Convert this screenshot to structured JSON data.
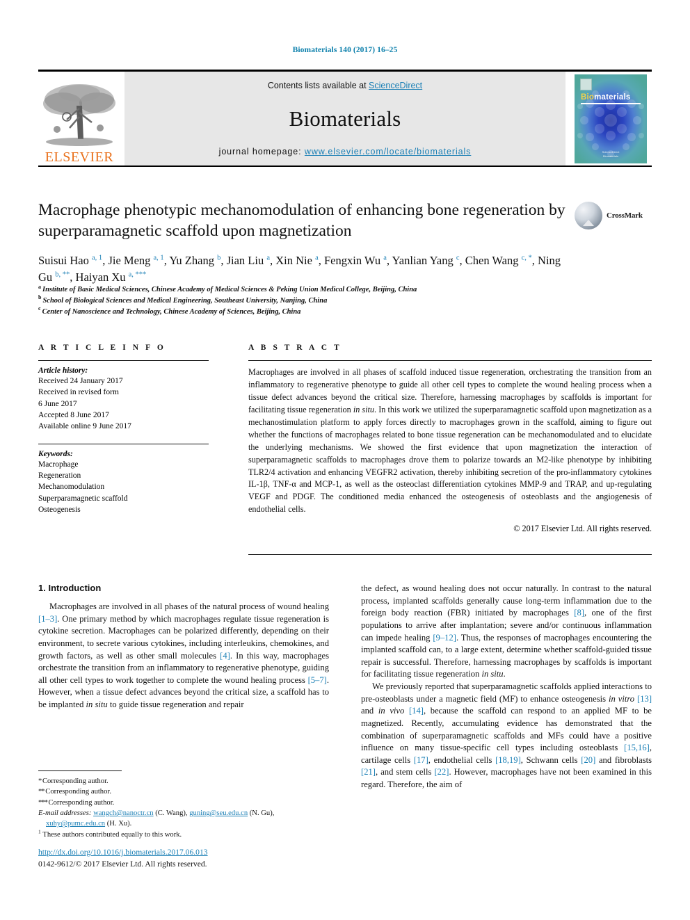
{
  "running_head": "Biomaterials 140 (2017) 16–25",
  "masthead": {
    "publisher_name": "ELSEVIER",
    "contents_line_prefix": "Contents lists available at ",
    "contents_line_link": "ScienceDirect",
    "journal_title": "Biomaterials",
    "homepage_prefix": "journal homepage: ",
    "homepage_url": "www.elsevier.com/locate/biomaterials",
    "cover": {
      "title_first": "Bio",
      "title_rest": "materials",
      "footer_line1": "ScienceDirect",
      "footer_line2": "Biomaterials"
    }
  },
  "article": {
    "title": "Macrophage phenotypic mechanomodulation of enhancing bone regeneration by superparamagnetic scaffold upon magnetization",
    "crossmark_label": "CrossMark",
    "authors": [
      {
        "name": "Suisui Hao",
        "marks": "a, 1",
        "sep": ", "
      },
      {
        "name": "Jie Meng",
        "marks": "a, 1",
        "sep": ", "
      },
      {
        "name": "Yu Zhang",
        "marks": "b",
        "sep": ", "
      },
      {
        "name": "Jian Liu",
        "marks": "a",
        "sep": ", "
      },
      {
        "name": "Xin Nie",
        "marks": "a",
        "sep": ", "
      },
      {
        "name": "Fengxin Wu",
        "marks": "a",
        "sep": ", "
      },
      {
        "name": "Yanlian Yang",
        "marks": "c",
        "sep": ", "
      },
      {
        "name": "Chen Wang",
        "marks": "c, *",
        "sep": ", "
      },
      {
        "name": "Ning Gu",
        "marks": "b, **",
        "sep": ", "
      },
      {
        "name": "Haiyan Xu",
        "marks": "a, ***",
        "sep": ""
      }
    ],
    "affiliations": [
      {
        "mark": "a",
        "text": "Institute of Basic Medical Sciences, Chinese Academy of Medical Sciences & Peking Union Medical College, Beijing, China"
      },
      {
        "mark": "b",
        "text": "School of Biological Sciences and Medical Engineering, Southeast University, Nanjing, China"
      },
      {
        "mark": "c",
        "text": "Center of Nanoscience and Technology, Chinese Academy of Sciences, Beijing, China"
      }
    ]
  },
  "article_info": {
    "heading": "A R T I C L E  I N F O",
    "history_heading": "Article history:",
    "history": [
      "Received 24 January 2017",
      "Received in revised form",
      "6 June 2017",
      "Accepted 8 June 2017",
      "Available online 9 June 2017"
    ],
    "keywords_heading": "Keywords:",
    "keywords": [
      "Macrophage",
      "Regeneration",
      "Mechanomodulation",
      "Superparamagnetic scaffold",
      "Osteogenesis"
    ]
  },
  "abstract": {
    "heading": "A B S T R A C T",
    "paragraph_parts": [
      {
        "t": "Macrophages are involved in all phases of scaffold induced tissue regeneration, orchestrating the transition from an inflammatory to regenerative phenotype to guide all other cell types to complete the wound healing process when a tissue defect advances beyond the critical size. Therefore, harnessing macrophages by scaffolds is important for facilitating tissue regeneration ",
        "i": false
      },
      {
        "t": "in situ",
        "i": true
      },
      {
        "t": ". In this work we utilized the superparamagnetic scaffold upon magnetization as a mechanostimulation platform to apply forces directly to macrophages grown in the scaffold, aiming to figure out whether the functions of macrophages related to bone tissue regeneration can be mechanomodulated and to elucidate the underlying mechanisms. We showed the first evidence that upon magnetization the interaction of superparamagnetic scaffolds to macrophages drove them to polarize towards an M2-like phenotype by inhibiting TLR2/4 activation and enhancing VEGFR2 activation, thereby inhibiting secretion of the pro-inflammatory cytokines IL-1β, TNF-α and MCP-1, as well as the osteoclast differentiation cytokines MMP-9 and TRAP, and up-regulating VEGF and PDGF. The conditioned media enhanced the osteogenesis of osteoblasts and the angiogenesis of endothelial cells.",
        "i": false
      }
    ],
    "copyright": "© 2017 Elsevier Ltd. All rights reserved."
  },
  "body": {
    "section_heading": "1. Introduction",
    "left_paragraph_1": "Macrophages are involved in all phases of the natural process of wound healing [1–3]. One primary method by which macrophages regulate tissue regeneration is cytokine secretion. Macrophages can be polarized differently, depending on their environment, to secrete various cytokines, including interleukins, chemokines, and growth factors, as well as other small molecules [4]. In this way, macrophages orchestrate the transition from an inflammatory to regenerative phenotype, guiding all other cell types to work together to complete the wound healing process [5–7]. However, when a tissue defect advances beyond the critical size, a scaffold has to be implanted in situ to guide tissue regeneration and repair",
    "right_paragraph_1": "the defect, as wound healing does not occur naturally. In contrast to the natural process, implanted scaffolds generally cause long-term inflammation due to the foreign body reaction (FBR) initiated by macrophages [8], one of the first populations to arrive after implantation; severe and/or continuous inflammation can impede healing [9–12]. Thus, the responses of macrophages encountering the implanted scaffold can, to a large extent, determine whether scaffold-guided tissue repair is successful. Therefore, harnessing macrophages by scaffolds is important for facilitating tissue regeneration in situ.",
    "right_paragraph_2": "We previously reported that superparamagnetic scaffolds applied interactions to pre-osteoblasts under a magnetic field (MF) to enhance osteogenesis in vitro [13] and in vivo [14], because the scaffold can respond to an applied MF to be magnetized. Recently, accumulating evidence has demonstrated that the combination of superparamagnetic scaffolds and MFs could have a positive influence on many tissue-specific cell types including osteoblasts [15,16], cartilage cells [17], endothelial cells [18,19], Schwann cells [20] and fibroblasts [21], and stem cells [22]. However, macrophages have not been examined in this regard. Therefore, the aim of"
  },
  "footnotes": {
    "line1": "Corresponding author.",
    "line2": "Corresponding author.",
    "line3": "Corresponding author.",
    "email_label": "E-mail addresses:",
    "email1": "wangch@nanoctr.cn",
    "email1_owner": "(C. Wang)",
    "email2": "guning@seu.edu.cn",
    "email2_owner": "(N. Gu)",
    "email3": "xuhy@pumc.edu.cn",
    "email3_owner": "(H. Xu)",
    "equal_contrib_mark": "1",
    "equal_contrib": "These authors contributed equally to this work."
  },
  "footer": {
    "doi": "http://dx.doi.org/10.1016/j.biomaterials.2017.06.013",
    "issn_line": "0142-9612/© 2017 Elsevier Ltd. All rights reserved."
  },
  "colors": {
    "link": "#1a7fb5",
    "elsevier_orange": "#E9711C",
    "banner_bg": "#e7e7e7"
  }
}
